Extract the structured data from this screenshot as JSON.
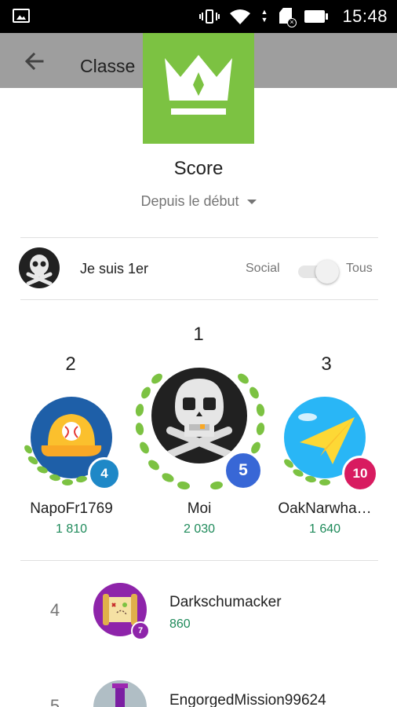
{
  "status_bar": {
    "time": "15:48",
    "icons": [
      "gallery-icon",
      "vibrate-icon",
      "wifi-icon",
      "data-arrows-icon",
      "sim-no-service-icon",
      "battery-icon"
    ]
  },
  "app_bar": {
    "title": "Classe",
    "back_icon": "arrow-left-icon",
    "color": "#9e9e9e"
  },
  "leaderboard": {
    "badge_icon": "crown-icon",
    "badge_color": "#7cc242",
    "title": "Score",
    "period": "Depuis le début"
  },
  "me_row": {
    "label": "Je suis 1er",
    "toggle_left": "Social",
    "toggle_right": "Tous",
    "toggle_on": true
  },
  "podium": [
    {
      "rank": "1",
      "name": "Moi",
      "score": "2 030",
      "level": "5",
      "level_color": "#3867d6",
      "avatar": "skull-crossbones-avatar"
    },
    {
      "rank": "2",
      "name": "NapoFr1769",
      "score": "1 810",
      "level": "4",
      "level_color": "#1e88c7",
      "avatar": "baseball-cap-avatar"
    },
    {
      "rank": "3",
      "name": "OakNarwha…",
      "score": "1 640",
      "level": "10",
      "level_color": "#d81b60",
      "avatar": "paper-plane-avatar"
    }
  ],
  "list": [
    {
      "rank": "4",
      "name": "Darkschumacker",
      "score": "860",
      "level": "7",
      "level_color": "#8e24aa",
      "avatar": "treasure-map-avatar"
    },
    {
      "rank": "5",
      "name": "EngorgedMission99624",
      "avatar": "tower-avatar"
    }
  ],
  "colors": {
    "score_green": "#1e8a5a",
    "laurel_green": "#7cc242"
  }
}
